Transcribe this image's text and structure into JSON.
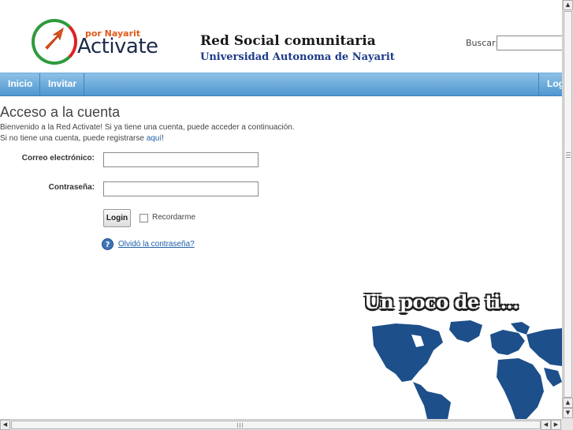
{
  "header": {
    "logo_small": "por Nayarit",
    "logo_main": "Activate",
    "site_title": "Red Social comunitaria",
    "site_subtitle": "Universidad Autonoma de Nayarit",
    "search_label": "Buscar:",
    "search_value": ""
  },
  "nav": {
    "items": [
      {
        "label": "Inicio"
      },
      {
        "label": "Invitar"
      }
    ],
    "login_label": "Login"
  },
  "main": {
    "title": "Acceso a la cuenta",
    "welcome_text": "Bienvenido a la Red Activate! Si ya tiene una cuenta, puede acceder a continuación.",
    "register_prefix": "Si no tiene una cuenta, puede registrarse ",
    "register_link": "aquí",
    "register_suffix": "!",
    "email_label": "Correo electrónico:",
    "email_value": "",
    "password_label": "Contraseña:",
    "password_value": "",
    "login_button": "Login",
    "remember_label": "Recordarme",
    "remember_checked": false,
    "forgot_link": "Olvidó la contraseña?"
  },
  "promo": {
    "title": "Un poco de ti..."
  },
  "colors": {
    "nav_top": "#8ec1e6",
    "nav_bottom": "#4f97d1",
    "link": "#1f5fa8",
    "map_ocean": "#ffffff",
    "map_land": "#1d4f8a"
  },
  "icons": [
    "logo-arrow-icon",
    "help-icon",
    "checkbox-icon",
    "scroll-arrow-icon"
  ]
}
